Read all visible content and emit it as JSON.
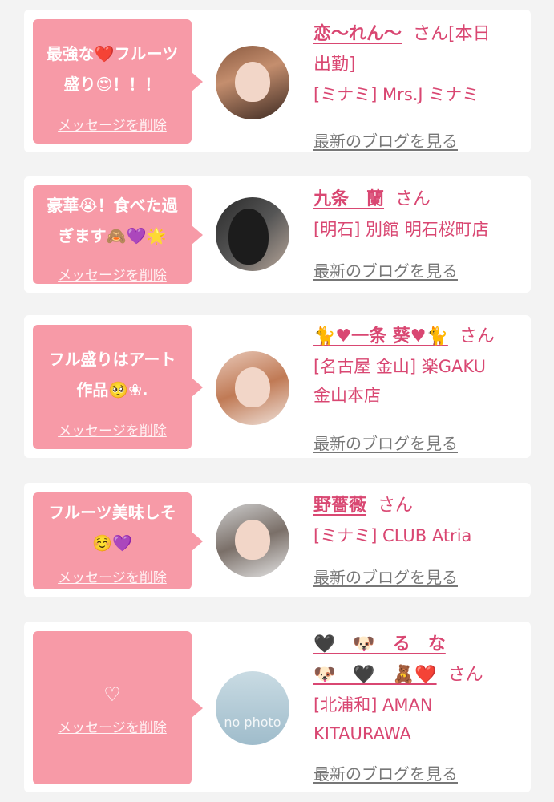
{
  "colors": {
    "bubble": "#f79aa7",
    "name": "#d94772",
    "link": "#777777"
  },
  "common": {
    "delete_label": "メッセージを削除",
    "blog_label": "最新のブログを見る"
  },
  "cards": [
    {
      "message_line1": "最強な❤️フルーツ",
      "message_line2": "盛り😍！！！",
      "name": "恋〜れん〜",
      "san": "さん[本日",
      "name_line2": "出勤]",
      "shop": "[ミナミ] Mrs.J ミナミ"
    },
    {
      "message_line1": "豪華😭！食べた過",
      "message_line2": "ぎます🙈💜🌟",
      "name": "九条　蘭",
      "san": "さん",
      "shop": "[明石] 別館 明石桜町店"
    },
    {
      "message_line1": "フル盛りはアート",
      "message_line2": "作品🥺❀.",
      "name": "🐈♥一条 葵♥🐈",
      "san": "さん",
      "shop": "[名古屋 金山] 楽GAKU",
      "shop_line2": "金山本店"
    },
    {
      "message_line1": "フルーツ美味しそ",
      "message_line2": "☺️💜",
      "name": "野薔薇",
      "san": "さん",
      "shop": "[ミナミ] CLUB Atria"
    },
    {
      "message_line1": "♡",
      "name": "🖤　🐶　る　な",
      "name_line2": "🐶　🖤　🧸❤️",
      "san": "さん",
      "shop": "[北浦和] AMAN",
      "shop_line2": "KITAURAWA",
      "avatar_text": "no photo"
    }
  ]
}
